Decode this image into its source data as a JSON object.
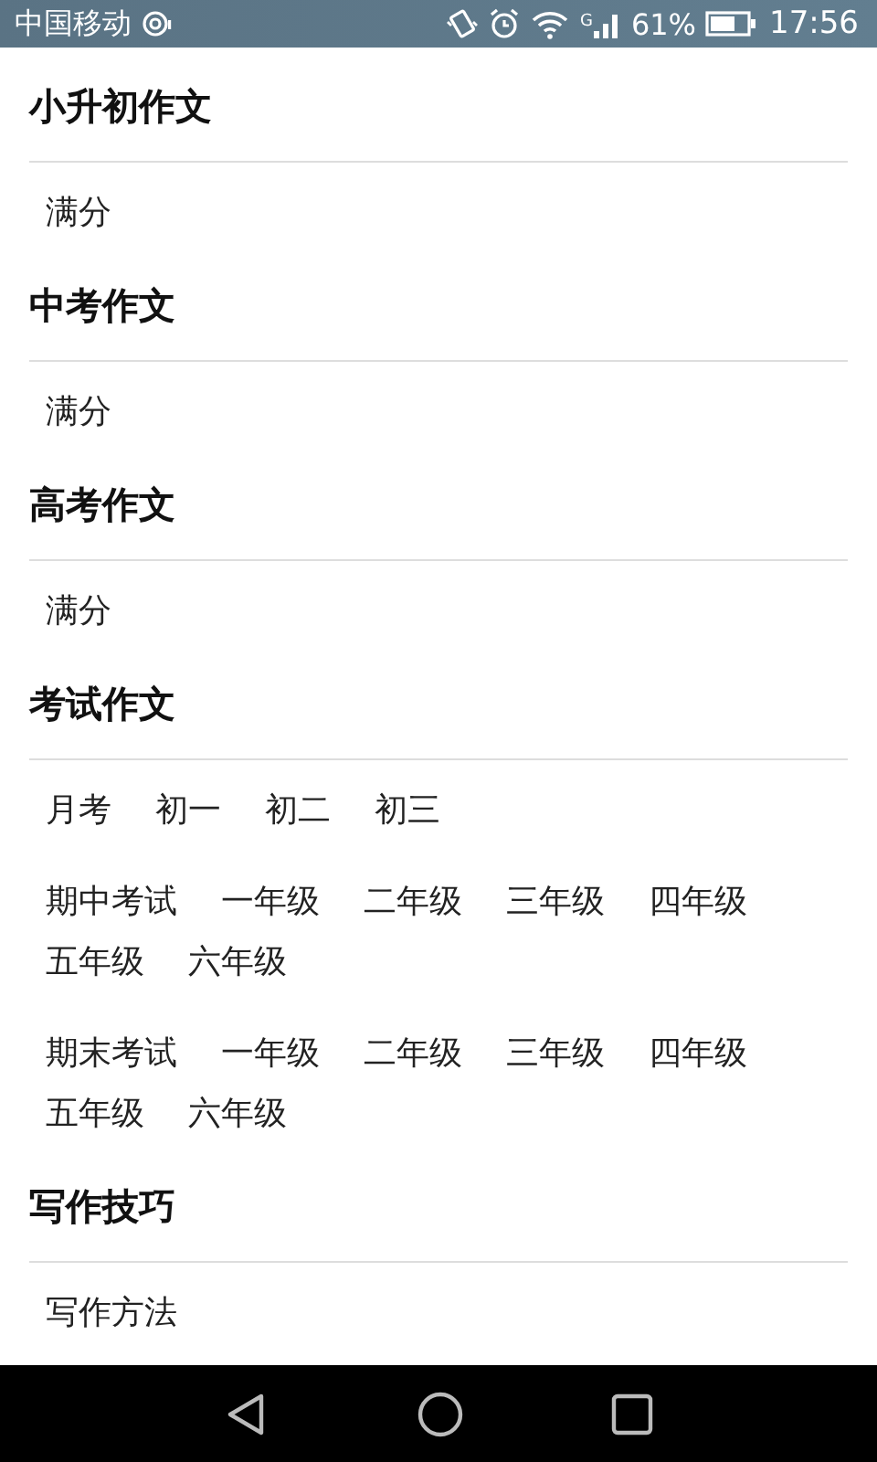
{
  "status_bar": {
    "carrier": "中国移动",
    "signal_type": "G",
    "battery": "61%",
    "time": "17:56"
  },
  "sections": [
    {
      "title": "小升初作文",
      "groups": [
        {
          "links": [
            "满分"
          ]
        }
      ]
    },
    {
      "title": "中考作文",
      "groups": [
        {
          "links": [
            "满分"
          ]
        }
      ]
    },
    {
      "title": "高考作文",
      "groups": [
        {
          "links": [
            "满分"
          ]
        }
      ]
    },
    {
      "title": "考试作文",
      "groups": [
        {
          "links": [
            "月考",
            "初一",
            "初二",
            "初三"
          ]
        },
        {
          "links": [
            "期中考试",
            "一年级",
            "二年级",
            "三年级",
            "四年级",
            "五年级",
            "六年级"
          ]
        },
        {
          "links": [
            "期末考试",
            "一年级",
            "二年级",
            "三年级",
            "四年级",
            "五年级",
            "六年级"
          ]
        }
      ]
    },
    {
      "title": "写作技巧",
      "groups": [
        {
          "links": [
            "写作方法"
          ]
        }
      ]
    }
  ]
}
